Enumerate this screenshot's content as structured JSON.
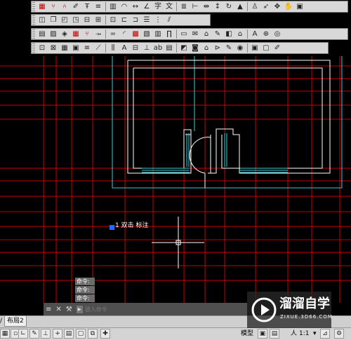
{
  "colors": {
    "grid": "#cc0000",
    "room": "#ffffff",
    "outline": "#3fc8d8",
    "selection": "#1a6fff",
    "cursor": "#ffffff"
  },
  "toolbars": [
    {
      "id": "row1",
      "icons": [
        "grid-icon",
        "fork-icon",
        "line-fork-icon",
        "brush-icon",
        "text-top-icon",
        "align-icon",
        "column-icon",
        "arc-icon",
        "measure-icon",
        "angle-icon",
        "text-tool-icon",
        "text-multi-icon",
        "stairs-icon",
        "dim-icon",
        "dim-arrow-icon",
        "dim-vertical-icon",
        "circle-arrow-icon",
        "mountain-icon",
        "person-icon",
        "pointer-icon",
        "move-icon",
        "pan-icon",
        "clipboard-icon"
      ]
    },
    {
      "id": "row2",
      "icons": [
        "layers-icon",
        "layer-copy-icon",
        "layer-merge-icon",
        "layer-split-icon",
        "window-icon",
        "door-icon",
        "window-double-icon",
        "beam-icon",
        "slab-icon",
        "column-list-icon",
        "list-icon",
        "hatch-icon"
      ]
    },
    {
      "id": "row3",
      "icons": [
        "properties-icon",
        "match-icon",
        "stack-icon",
        "grid-red-icon",
        "axis-icon",
        "move-axis-icon",
        "equal-icon",
        "door-swing-icon",
        "table-red-icon",
        "note-icon",
        "wall-icon",
        "pillar-icon",
        "window-frame-icon",
        "envelope-icon",
        "lock-icon",
        "pencil-icon",
        "book-icon",
        "roof-icon",
        "text-letter-icon",
        "circle-cross-icon",
        "target-icon"
      ]
    },
    {
      "id": "row4",
      "icons": [
        "zoom-window-icon",
        "pan-view-icon",
        "grid-view-icon",
        "image-icon",
        "stair-icon",
        "ramp-icon",
        "rail-icon",
        "text-a-icon",
        "section-icon",
        "elevation-icon",
        "abc-icon",
        "table-icon",
        "render-icon",
        "camera-icon",
        "building-icon",
        "car-icon",
        "paint-icon",
        "eye-icon",
        "cube-icon",
        "frame-icon",
        "brush-edit-icon"
      ]
    }
  ],
  "canvas": {
    "label_text": "1 双击  标注"
  },
  "command_history": [
    "命令:",
    "命令:",
    "命令:"
  ],
  "command": {
    "placeholder": "键入命令"
  },
  "tabs": {
    "layout2": "布局2"
  },
  "status": {
    "model": "模型",
    "scale": "1:1",
    "scale_prefix": "人"
  },
  "watermark": {
    "brand": "溜溜自学",
    "url": "ZIXUE.3D66.COM"
  }
}
